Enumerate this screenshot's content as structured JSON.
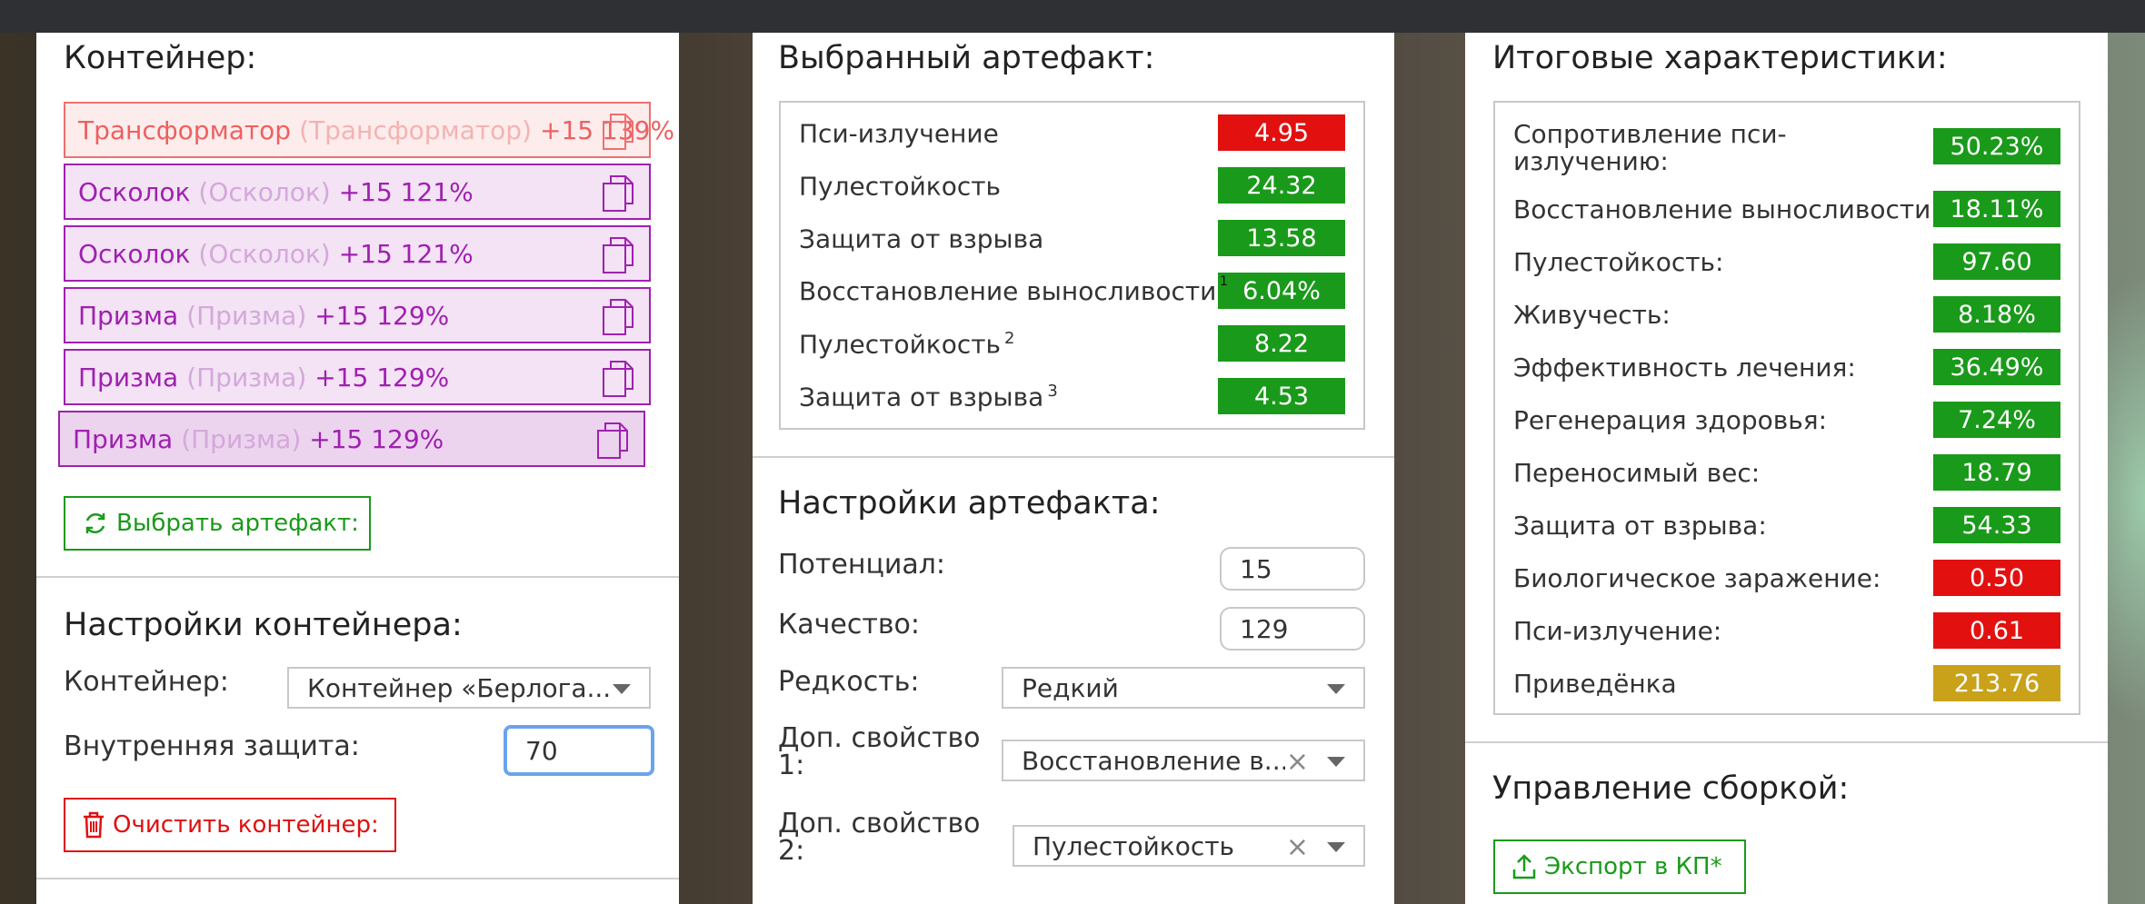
{
  "container_panel": {
    "title": "Контейнер:",
    "slots": [
      {
        "name": "Трансформатор",
        "sub": "(Трансформатор)",
        "bonus": "+15 139%"
      },
      {
        "name": "Осколок",
        "sub": "(Осколок)",
        "bonus": "+15 121%"
      },
      {
        "name": "Осколок",
        "sub": "(Осколок)",
        "bonus": "+15 121%"
      },
      {
        "name": "Призма",
        "sub": "(Призма)",
        "bonus": "+15 129%"
      },
      {
        "name": "Призма",
        "sub": "(Призма)",
        "bonus": "+15 129%"
      },
      {
        "name": "Призма",
        "sub": "(Призма)",
        "bonus": "+15 129%"
      }
    ],
    "choose_button": "Выбрать артефакт:"
  },
  "container_settings": {
    "title": "Настройки контейнера:",
    "container_label": "Контейнер:",
    "container_value": "Контейнер «Берлога...",
    "protection_label": "Внутренняя защита:",
    "protection_value": "70",
    "clear_button": "Очистить контейнер:"
  },
  "selected_artifact": {
    "title": "Выбранный артефакт:",
    "stats": [
      {
        "name": "Пси-излучение",
        "sup": "",
        "value": "4.95",
        "kind": "neg"
      },
      {
        "name": "Пулестойкость",
        "sup": "",
        "value": "24.32",
        "kind": "pos"
      },
      {
        "name": "Защита от взрыва",
        "sup": "",
        "value": "13.58",
        "kind": "pos"
      },
      {
        "name": "Восстановление выносливости",
        "sup": "1",
        "value": "6.04%",
        "kind": "pos"
      },
      {
        "name": "Пулестойкость",
        "sup": "2",
        "value": "8.22",
        "kind": "pos"
      },
      {
        "name": "Защита от взрыва",
        "sup": "3",
        "value": "4.53",
        "kind": "pos"
      }
    ]
  },
  "artifact_settings": {
    "title": "Настройки артефакта:",
    "potential_label": "Потенциал:",
    "potential_value": "15",
    "quality_label": "Качество:",
    "quality_value": "129",
    "rarity_label": "Редкость:",
    "rarity_value": "Редкий",
    "extra1_label_a": "Доп. свойство",
    "extra1_label_b": "1:",
    "extra1_value": "Восстановление в...",
    "extra2_label_a": "Доп. свойство",
    "extra2_label_b": "2:",
    "extra2_value": "Пулестойкость",
    "clear_symbol": "×"
  },
  "totals": {
    "title": "Итоговые характеристики:",
    "stats": [
      {
        "name_a": "Сопротивление пси-",
        "name_b": "излучению:",
        "value": "50.23%",
        "kind": "pos"
      },
      {
        "name_a": "Восстановление выносливости:",
        "name_b": "",
        "value": "18.11%",
        "kind": "pos"
      },
      {
        "name_a": "Пулестойкость:",
        "name_b": "",
        "value": "97.60",
        "kind": "pos"
      },
      {
        "name_a": "Живучесть:",
        "name_b": "",
        "value": "8.18%",
        "kind": "pos"
      },
      {
        "name_a": "Эффективность лечения:",
        "name_b": "",
        "value": "36.49%",
        "kind": "pos"
      },
      {
        "name_a": "Регенерация здоровья:",
        "name_b": "",
        "value": "7.24%",
        "kind": "pos"
      },
      {
        "name_a": "Переносимый вес:",
        "name_b": "",
        "value": "18.79",
        "kind": "pos"
      },
      {
        "name_a": "Защита от взрыва:",
        "name_b": "",
        "value": "54.33",
        "kind": "pos"
      },
      {
        "name_a": "Биологическое заражение:",
        "name_b": "",
        "value": "0.50",
        "kind": "neg"
      },
      {
        "name_a": "Пси-излучение:",
        "name_b": "",
        "value": "0.61",
        "kind": "neg"
      },
      {
        "name_a": "Приведёнка",
        "name_b": "",
        "value": "213.76",
        "kind": "neu"
      }
    ]
  },
  "build_management": {
    "title": "Управление сборкой:",
    "export_button": "Экспорт в КП*"
  },
  "colors": {
    "positive": "#1a9a1a",
    "negative": "#e31010",
    "neutral": "#c9a21a",
    "artifact_purple": "#a020b0",
    "artifact_red": "#ee6060"
  }
}
